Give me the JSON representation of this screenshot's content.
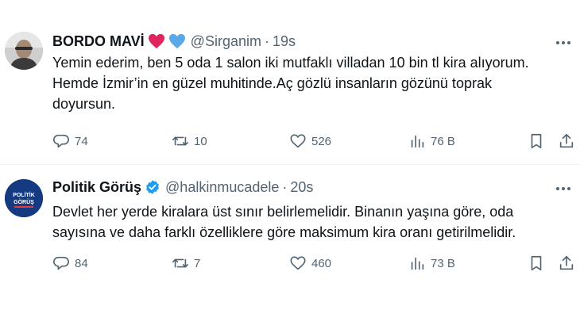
{
  "colors": {
    "text_primary": "#0f1419",
    "text_secondary": "#536471",
    "verified_blue": "#1d9bf0",
    "heart_red": "#f91880",
    "heart_blue": "#5aa9e6",
    "divider": "#eff3f4"
  },
  "tweets": [
    {
      "author": {
        "name": "BORDO MAVİ",
        "handle": "@Sirganim",
        "emoji": [
          "red-heart-icon",
          "blue-heart-icon"
        ]
      },
      "separator": "·",
      "time": "19s",
      "text_lines": [
        "Yemin ederim, ben 5 oda 1 salon  iki mutfaklı villadan 10 bin tl kira alıyorum.",
        "Hemde İzmir’in en güzel muhitinde.Aç gözlü insanların gözünü toprak",
        "doyursun."
      ],
      "stats": {
        "replies": "74",
        "retweets": "10",
        "likes": "526",
        "views": "76 B"
      }
    },
    {
      "author": {
        "name": "Politik Görüş",
        "handle": "@halkinmucadele",
        "verified": true,
        "avatar_text": [
          "POLİTİK",
          "GÖRÜŞ"
        ]
      },
      "separator": "·",
      "time": "20s",
      "text_lines": [
        "Devlet her yerde kiralara üst sınır belirlemelidir. Binanın yaşına göre, oda",
        "sayısına ve daha farklı özelliklere göre maksimum kira oranı getirilmelidir."
      ],
      "stats": {
        "replies": "84",
        "retweets": "7",
        "likes": "460",
        "views": "73 B"
      }
    }
  ]
}
